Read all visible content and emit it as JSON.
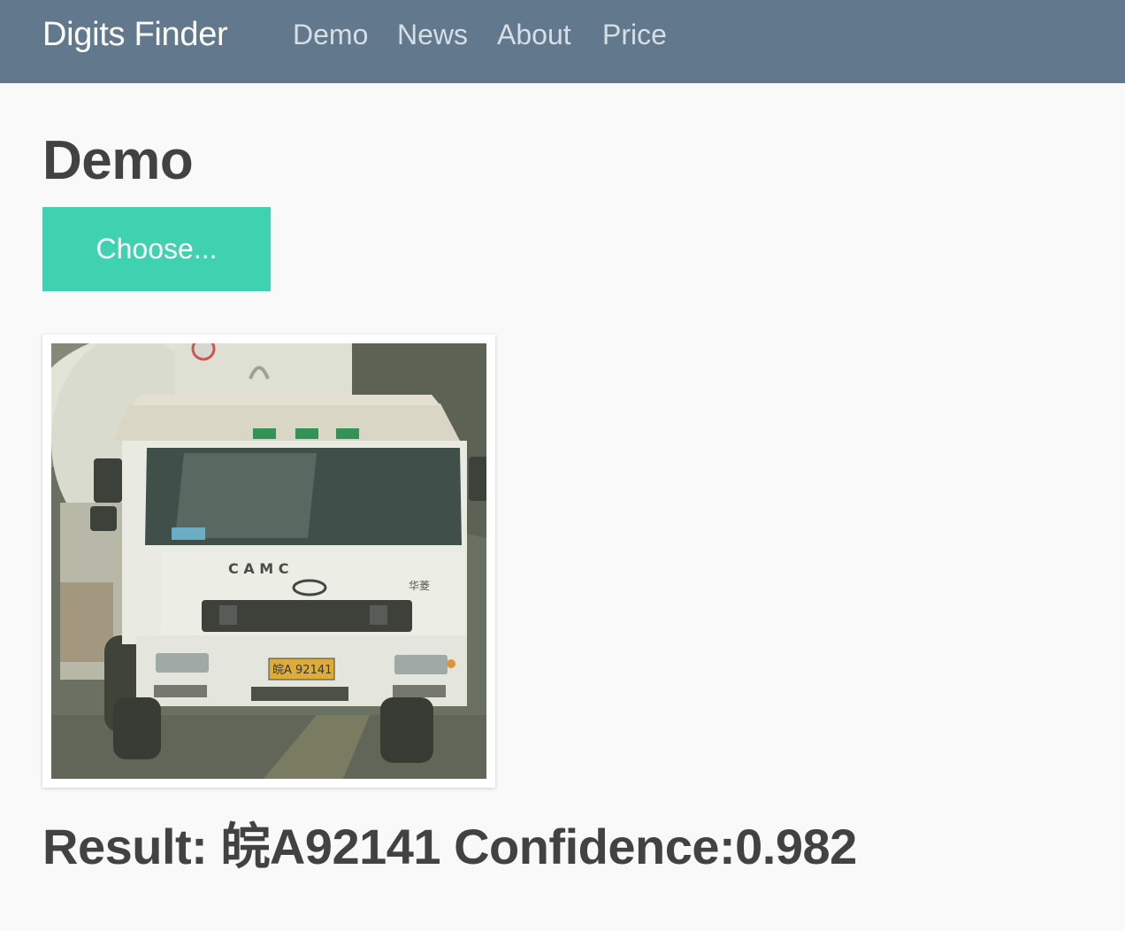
{
  "navbar": {
    "brand": "Digits Finder",
    "links": [
      {
        "label": "Demo"
      },
      {
        "label": "News"
      },
      {
        "label": "About"
      },
      {
        "label": "Price"
      }
    ]
  },
  "main": {
    "title": "Demo",
    "choose_button": "Choose...",
    "image": {
      "truck_brand_text": "C A M C",
      "plate_text": "皖A 92141",
      "cab_text": "华菱"
    },
    "result_text": "Result: 皖A92141 Confidence:0.982"
  },
  "colors": {
    "navbar_bg": "#62788c",
    "accent_button": "#40d2b0",
    "text_dark": "#424242",
    "page_bg": "#f9f9f9"
  }
}
